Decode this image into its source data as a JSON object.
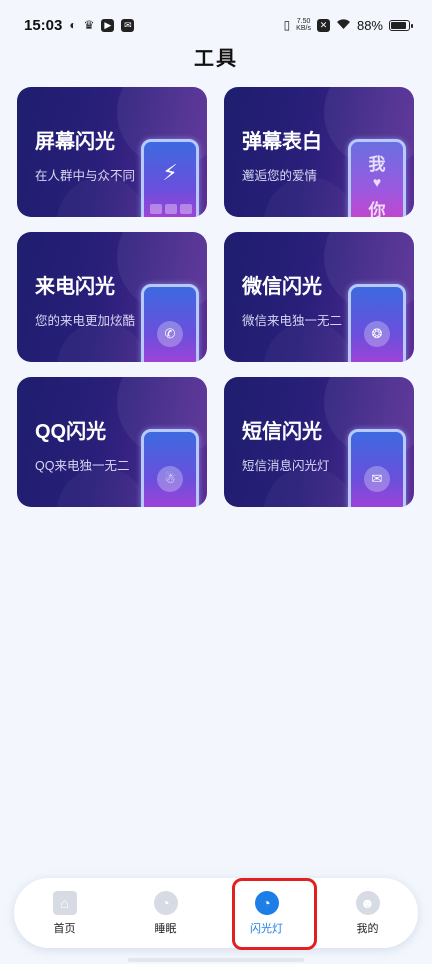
{
  "status_bar": {
    "time": "15:03",
    "net_speed_value": "7.50",
    "net_speed_unit": "KB/s",
    "battery": "88%",
    "battery_level": 0.88
  },
  "header": {
    "title": "工具"
  },
  "cards": [
    {
      "title": "屏幕闪光",
      "subtitle": "在人群中与众不同",
      "icon": "bolt-icon"
    },
    {
      "title": "弹幕表白",
      "subtitle": "邂逅您的爱情",
      "icon": "heart-text-icon",
      "phone_text_top": "我",
      "phone_text_bottom": "你"
    },
    {
      "title": "来电闪光",
      "subtitle": "您的来电更加炫酷",
      "icon": "incoming-call-icon"
    },
    {
      "title": "微信闪光",
      "subtitle": "微信来电独一无二",
      "icon": "wechat-icon"
    },
    {
      "title": "QQ闪光",
      "subtitle": "QQ来电独一无二",
      "icon": "qq-icon"
    },
    {
      "title": "短信闪光",
      "subtitle": "短信消息闪光灯",
      "icon": "sms-icon"
    }
  ],
  "bottom_nav": {
    "items": [
      {
        "label": "首页",
        "icon": "home-icon",
        "active": false
      },
      {
        "label": "睡眠",
        "icon": "sleep-icon",
        "active": false
      },
      {
        "label": "闪光灯",
        "icon": "flash-icon",
        "active": true
      },
      {
        "label": "我的",
        "icon": "profile-icon",
        "active": false
      }
    ]
  },
  "colors": {
    "accent": "#1e7ee8",
    "highlight": "#e0211f",
    "card_start": "#1e1e6e",
    "card_end": "#5a2e96"
  }
}
